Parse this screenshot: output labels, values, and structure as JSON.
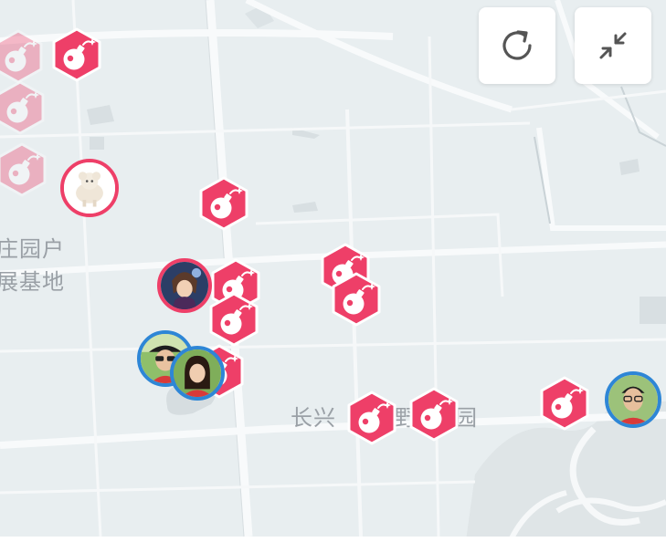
{
  "map": {
    "labels": [
      {
        "text": "庄园户",
        "name": "label-zhuangyuanhu"
      },
      {
        "text": "展基地",
        "name": "label-zhanjidi"
      },
      {
        "text": "长兴",
        "name": "label-changxing"
      },
      {
        "text": "野",
        "name": "label-ye"
      },
      {
        "text": "园",
        "name": "label-yuan"
      }
    ]
  },
  "controls": {
    "refresh_icon": "refresh-icon",
    "collapse_icon": "collapse-icon"
  },
  "markers": {
    "icon": "bomb-icon",
    "count": 14,
    "color": "#ee3f68",
    "faded_count": 3
  },
  "avatars": {
    "count": 5,
    "ring_colors": {
      "pink": "#ee3f68",
      "blue": "#2e86d6"
    }
  }
}
